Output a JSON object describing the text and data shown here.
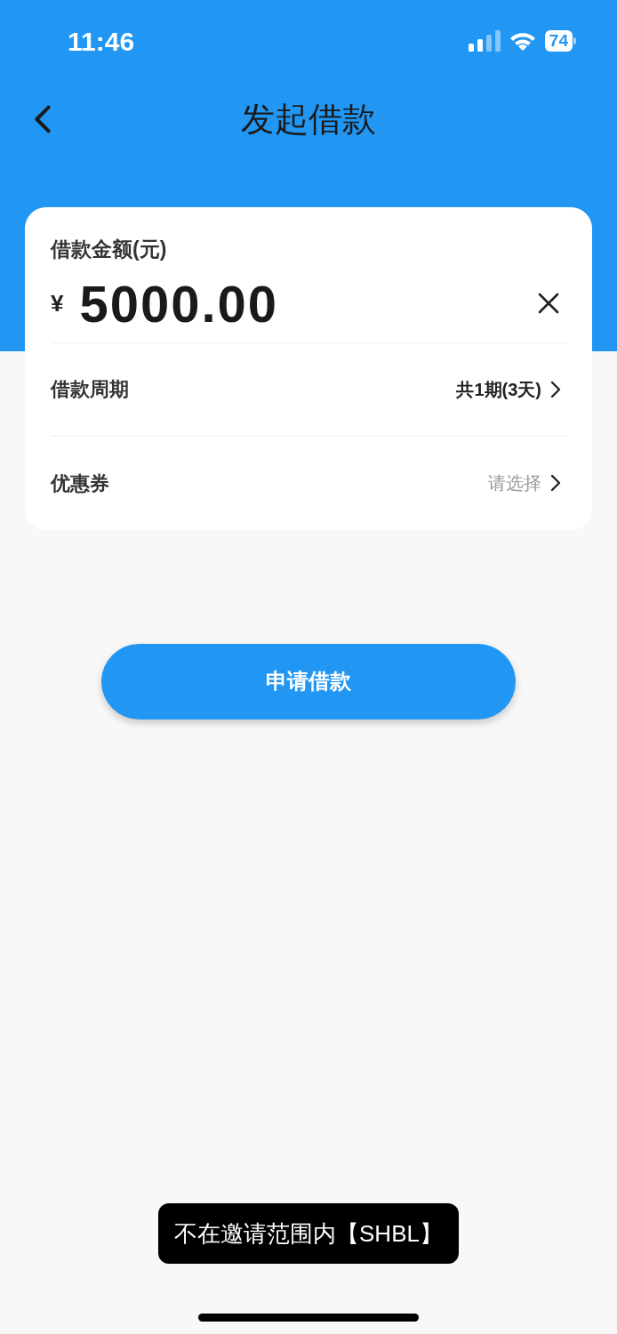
{
  "status_bar": {
    "time": "11:46",
    "battery": "74"
  },
  "header": {
    "title": "发起借款"
  },
  "card": {
    "amount_label": "借款金额(元)",
    "currency": "¥",
    "amount": "5000.00",
    "rows": [
      {
        "kind": "value",
        "label": "借款周期",
        "value": "共1期(3天)"
      },
      {
        "kind": "placeholder",
        "label": "优惠券",
        "value": "请选择"
      }
    ]
  },
  "submit_button": "申请借款",
  "toast": "不在邀请范围内【SHBL】"
}
